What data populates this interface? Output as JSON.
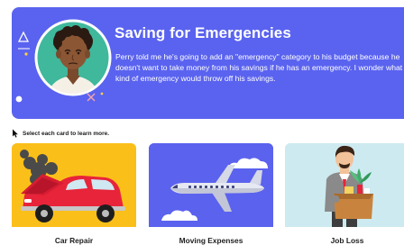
{
  "lesson": {
    "title": "Saving for Emergencies",
    "body": "Perry told me he's going to add an \"emergency\" category to his budget because he doesn't want to take money from his savings if he has an emergency. I wonder what kind of emergency would throw off his savings.",
    "instruction": "Select each card to learn more."
  },
  "cards": [
    {
      "label": "Car Repair",
      "image": "car-repair-illustration"
    },
    {
      "label": "Moving Expenses",
      "image": "airplane-illustration"
    },
    {
      "label": "Job Loss",
      "image": "job-loss-illustration"
    }
  ],
  "colors": {
    "hero": "#5a63ef",
    "card_car": "#fbbf1a",
    "card_moving": "#5b62ee",
    "card_job": "#cdeaf0"
  }
}
